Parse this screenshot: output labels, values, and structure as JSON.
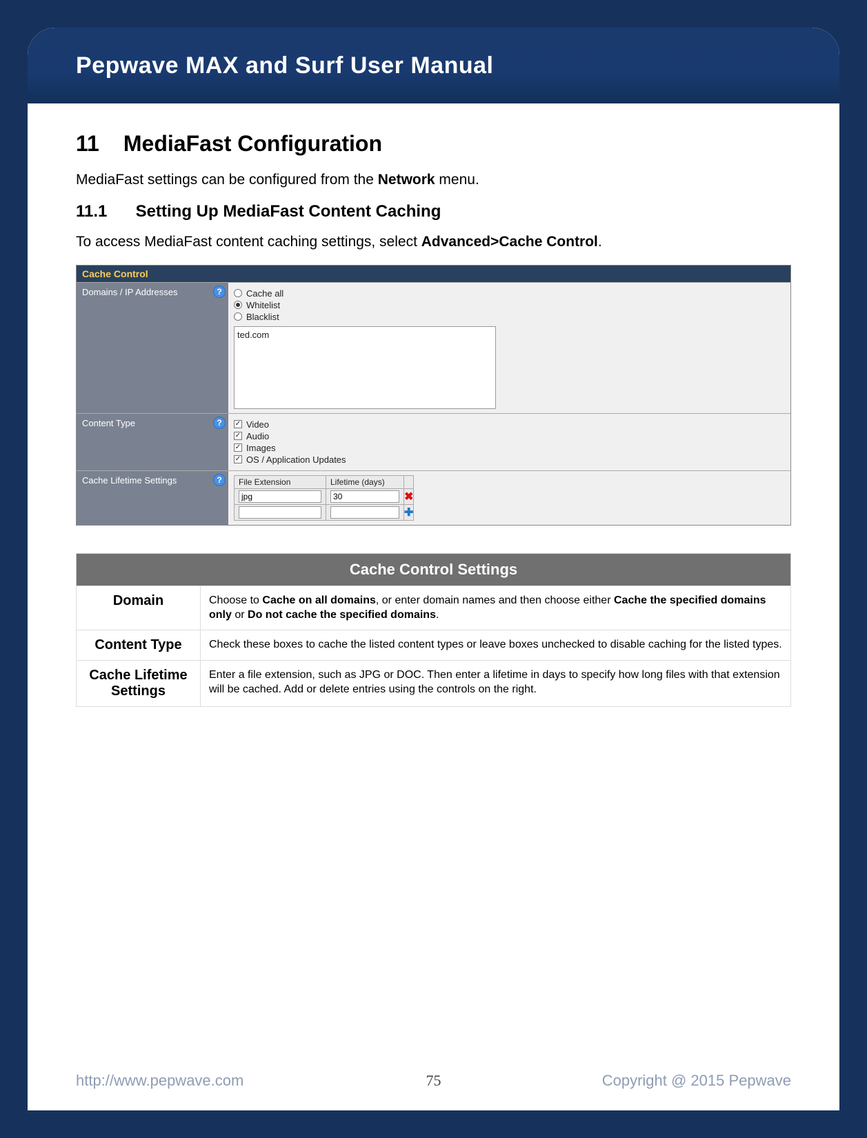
{
  "header": {
    "title": "Pepwave MAX and Surf User Manual"
  },
  "section": {
    "num": "11",
    "title": "MediaFast Configuration",
    "intro_pre": "MediaFast settings can be configured from the ",
    "intro_bold": "Network",
    "intro_post": " menu."
  },
  "subsection": {
    "num": "11.1",
    "title": "Setting Up MediaFast Content Caching",
    "lead_pre": "To access MediaFast content caching settings, select ",
    "lead_bold": "Advanced>Cache Control",
    "lead_post": "."
  },
  "ui": {
    "panel_title": "Cache Control",
    "domains_label": "Domains / IP Addresses",
    "radio": {
      "cache_all": "Cache all",
      "whitelist": "Whitelist",
      "blacklist": "Blacklist",
      "selected": "whitelist"
    },
    "textarea_value": "ted.com",
    "content_type_label": "Content Type",
    "content_types": [
      {
        "label": "Video",
        "checked": true
      },
      {
        "label": "Audio",
        "checked": true
      },
      {
        "label": "Images",
        "checked": true
      },
      {
        "label": "OS / Application Updates",
        "checked": true
      }
    ],
    "lifetime_label": "Cache Lifetime Settings",
    "lifetime_headers": {
      "ext": "File Extension",
      "days": "Lifetime (days)"
    },
    "lifetime_rows": [
      {
        "ext": "jpg",
        "days": "30"
      },
      {
        "ext": "",
        "days": ""
      }
    ]
  },
  "desc": {
    "title": "Cache Control Settings",
    "rows": [
      {
        "key": "Domain",
        "pre": "Choose to ",
        "b1": "Cache on all domains",
        "mid1": ", or enter domain names and then choose either ",
        "b2": "Cache the specified domains only",
        "mid2": " or ",
        "b3": "Do not cache the specified domains",
        "post": "."
      },
      {
        "key": "Content Type",
        "text": "Check these boxes to cache the listed content types or leave boxes unchecked to disable caching for the listed types."
      },
      {
        "key": "Cache Lifetime Settings",
        "text": "Enter a file extension, such as JPG or DOC. Then enter a lifetime in days to specify how long files with that extension will be cached. Add or delete entries using the controls on the right."
      }
    ]
  },
  "footer": {
    "url": "http://www.pepwave.com",
    "page": "75",
    "copyright": "Copyright @ 2015 Pepwave"
  }
}
